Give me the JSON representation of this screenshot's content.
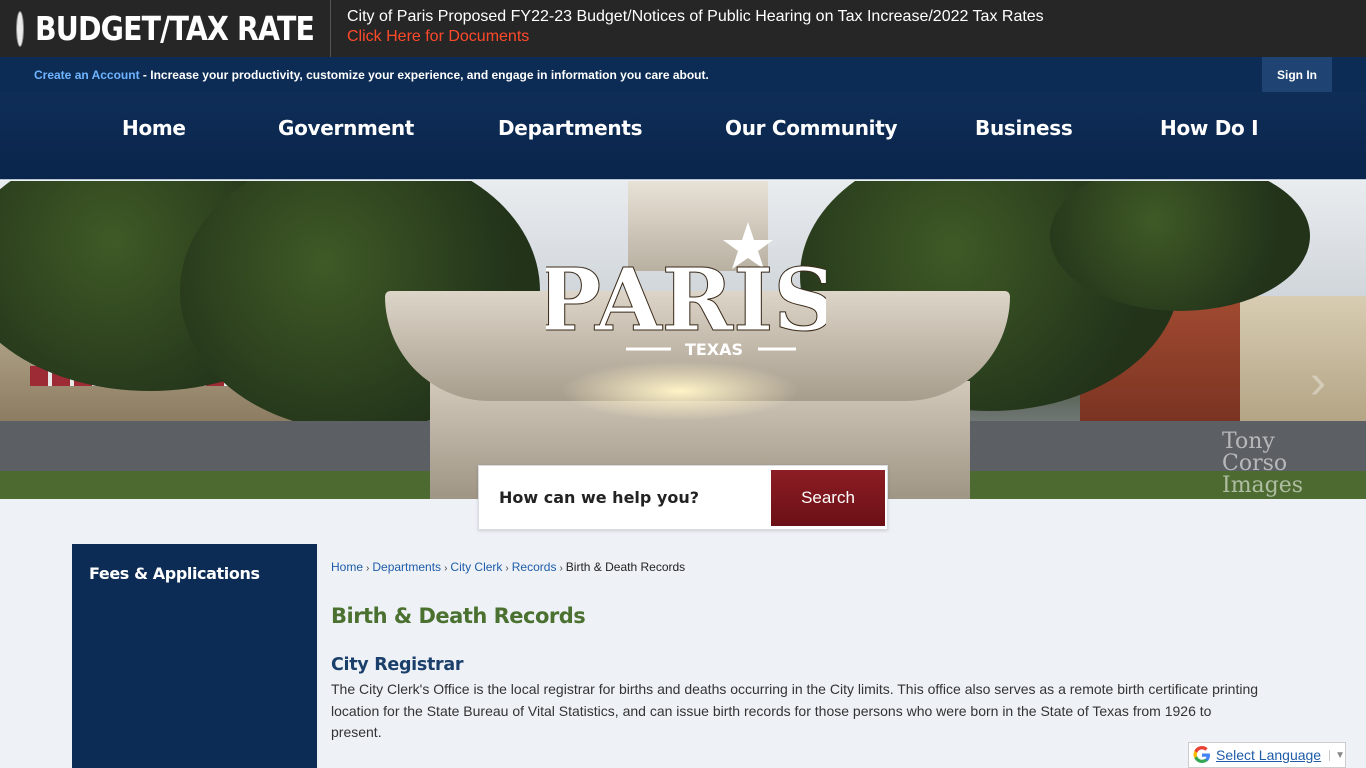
{
  "alert": {
    "label": "BUDGET/TAX RATE",
    "message": "City of Paris Proposed FY22-23 Budget/Notices of Public Hearing on Tax Increase/2022 Tax Rates",
    "link": "Click Here for Documents"
  },
  "account_bar": {
    "create_link": "Create an Account",
    "message": " - Increase your productivity, customize your experience, and engage in information you care about.",
    "sign_in": "Sign In"
  },
  "nav": {
    "items": [
      "Home",
      "Government",
      "Departments",
      "Our Community",
      "Business",
      "How Do I"
    ]
  },
  "banner": {
    "logo_text": "PARIS",
    "logo_subtext": "TEXAS",
    "watermark": "Tony Corso Images"
  },
  "search": {
    "placeholder": "How can we help you?",
    "button": "Search"
  },
  "sidebar": {
    "items": [
      "Fees & Applications"
    ]
  },
  "breadcrumb": {
    "items": [
      "Home",
      "Departments",
      "City Clerk",
      "Records"
    ],
    "current": "Birth & Death Records",
    "separator": "›"
  },
  "main": {
    "title": "Birth & Death Records",
    "section_heading": "City Registrar",
    "section_body": "The City Clerk's Office is the local registrar for births and deaths occurring in the City limits. This office also serves as a remote birth certificate printing location for the State Bureau of Vital Statistics, and can issue birth records for those persons who were born in the State of Texas from 1926 to present."
  },
  "translate": {
    "label": "Select Language",
    "caret": "▼"
  },
  "colors": {
    "navy": "#0c2c55",
    "alert_link": "#ff4a2a",
    "title_green": "#4b7130",
    "search_button": "#7a151c"
  }
}
